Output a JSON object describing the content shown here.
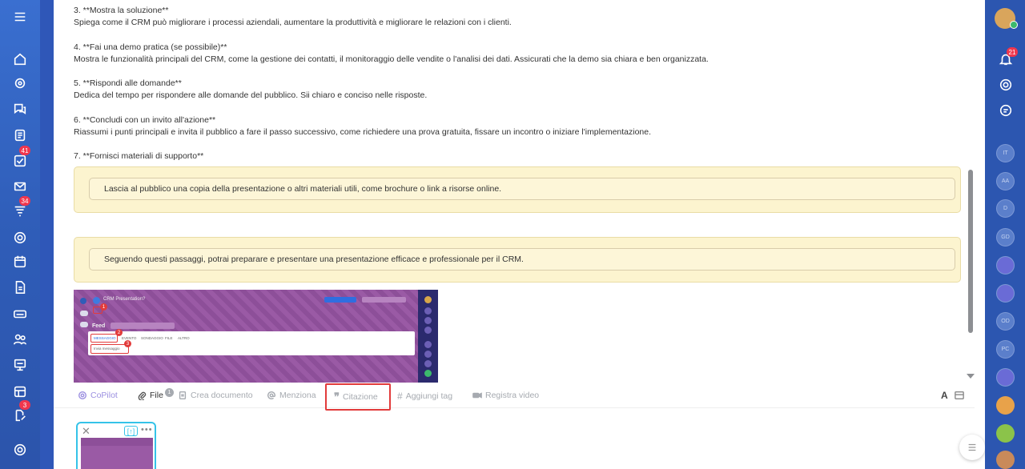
{
  "left_sidebar": {
    "items": [
      {
        "icon": "menu-icon"
      },
      {
        "icon": "home-icon"
      },
      {
        "icon": "copilot-icon"
      },
      {
        "icon": "chat-icon"
      },
      {
        "icon": "feed-icon"
      },
      {
        "icon": "tasks-icon",
        "badge": "41"
      },
      {
        "icon": "mail-icon"
      },
      {
        "icon": "crm-funnel-icon",
        "badge": "34"
      },
      {
        "icon": "target-icon"
      },
      {
        "icon": "calendar-icon"
      },
      {
        "icon": "document-icon"
      },
      {
        "icon": "drive-icon"
      },
      {
        "icon": "groups-icon"
      },
      {
        "icon": "presentation-icon"
      },
      {
        "icon": "planner-icon"
      },
      {
        "icon": "edit-icon",
        "badge": "3"
      },
      {
        "icon": "settings-icon"
      }
    ]
  },
  "content": {
    "steps": [
      {
        "title": "3. **Mostra la soluzione**",
        "text": "Spiega come il CRM può migliorare i processi aziendali, aumentare la produttività e migliorare le relazioni con i clienti."
      },
      {
        "title": "4. **Fai una demo pratica (se possibile)**",
        "text": "Mostra le funzionalità principali del CRM, come la gestione dei contatti, il monitoraggio delle vendite o l'analisi dei dati. Assicurati che la demo sia chiara e ben organizzata."
      },
      {
        "title": "5. **Rispondi alle domande**",
        "text": "Dedica del tempo per rispondere alle domande del pubblico. Sii chiaro e conciso nelle risposte."
      },
      {
        "title": "6. **Concludi con un invito all'azione**",
        "text": "Riassumi i punti principali e invita il pubblico a fare il passo successivo, come richiedere una prova gratuita, fissare un incontro o iniziare l'implementazione."
      },
      {
        "title": "7. **Fornisci materiali di supporto**"
      }
    ],
    "quote1": "Lascia al pubblico una copia della presentazione o altri materiali utili, come brochure o link a risorse online.",
    "quote2": "Seguendo questi passaggi, potrai preparare e presentare una presentazione efficace e professionale per il CRM."
  },
  "screenshot": {
    "title": "CRM Presentation?",
    "tab": "Feed",
    "items": [
      "MESSAGGIO",
      "EVENTO",
      "SONDAGGIO",
      "FILE",
      "ALTRO"
    ],
    "send_label": "Invia messaggio",
    "markers": [
      "1",
      "2",
      "3"
    ]
  },
  "toolbar": {
    "copilot": "CoPilot",
    "file": "File",
    "file_count": "1",
    "create_doc": "Crea documento",
    "mention": "Menziona",
    "quote": "Citazione",
    "tag": "Aggiungi tag",
    "record_video": "Registra video",
    "format": "A"
  },
  "right_sidebar": {
    "notification_badge": "21",
    "avatars": [
      "IT",
      "AA",
      "D",
      "GD",
      "",
      "",
      "OD",
      "PC",
      ""
    ]
  }
}
